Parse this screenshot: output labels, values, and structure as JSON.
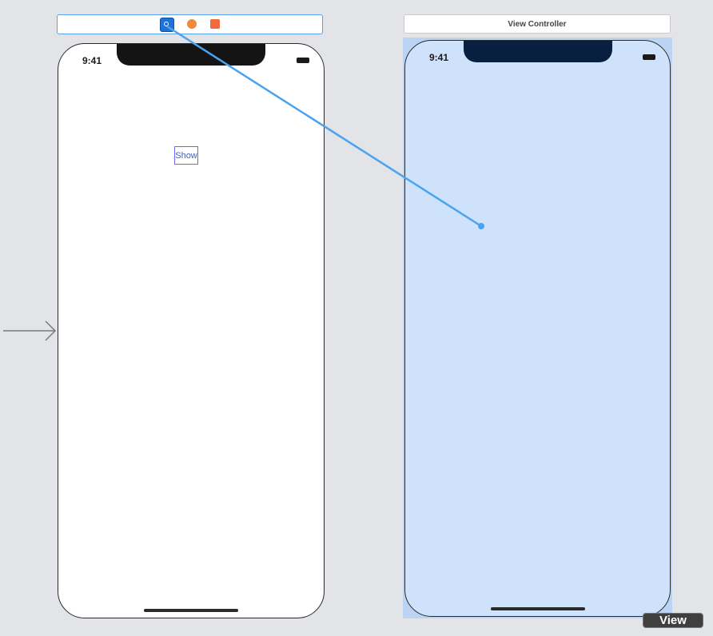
{
  "canvas": {
    "background": "#e3e4e8"
  },
  "scene_left": {
    "dock_icons": [
      "view-controller-icon",
      "first-responder-icon",
      "exit-icon"
    ],
    "status_time": "9:41",
    "button_label": "Show"
  },
  "scene_right": {
    "title": "View Controller",
    "status_time": "9:41",
    "highlight_color": "#cfe2fb"
  },
  "segue": {
    "color": "#4aa3ef"
  },
  "badge": {
    "label": "View"
  }
}
